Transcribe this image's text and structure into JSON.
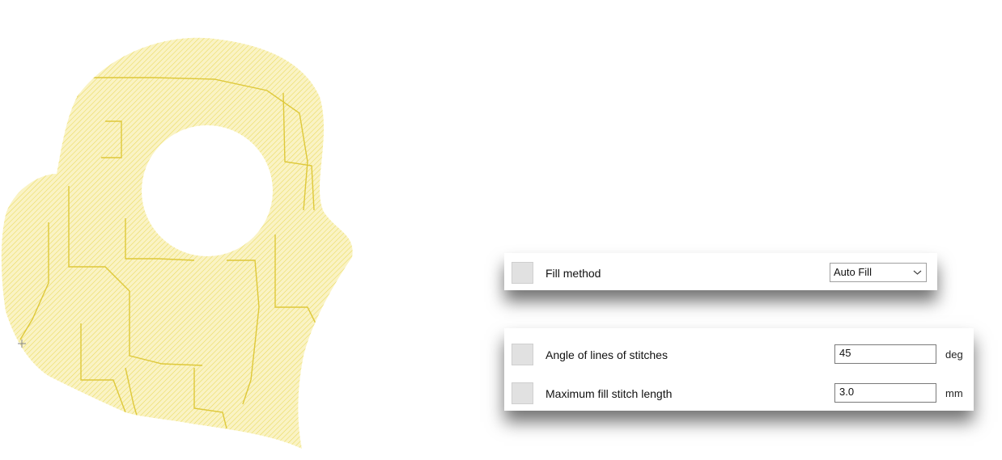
{
  "colors": {
    "stitch_fill": "#faf3c4",
    "stitch_line": "#e9d95c",
    "stitch_path": "#dec83a",
    "card_background": "#ffffff",
    "checkbox": "#e1e1e1"
  },
  "fill_panel": {
    "fill_method_label": "Fill method",
    "fill_method_value": "Auto Fill"
  },
  "params_panel": {
    "angle_label": "Angle of lines of stitches",
    "angle_value": "45",
    "angle_unit": "deg",
    "max_length_label": "Maximum fill stitch length",
    "max_length_value": "3.0",
    "max_length_unit": "mm"
  }
}
